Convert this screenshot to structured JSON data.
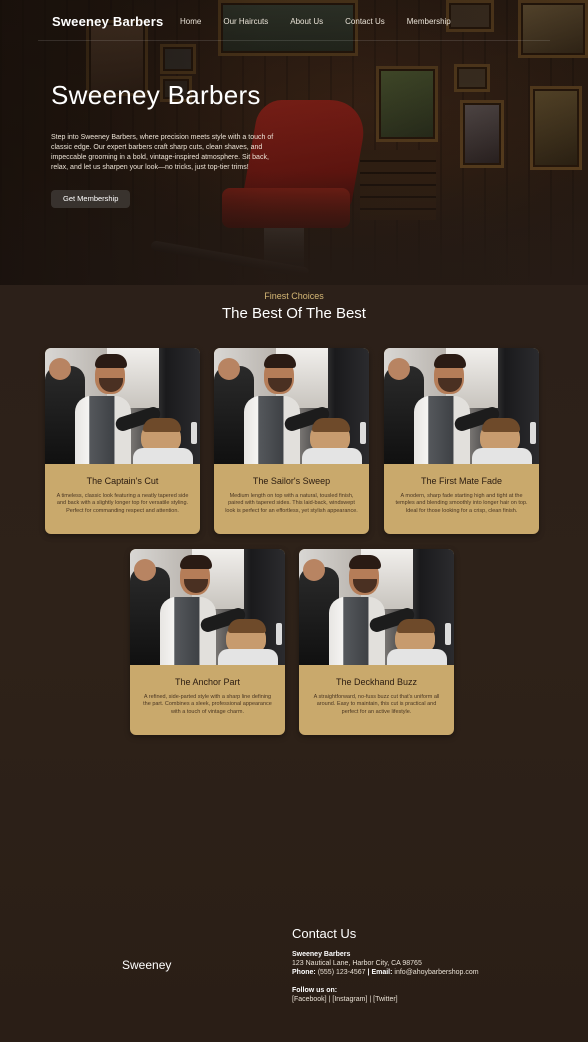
{
  "nav": {
    "brand": "Sweeney Barbers",
    "links": [
      "Home",
      "Our Haircuts",
      "About Us",
      "Contact Us",
      "Membership"
    ]
  },
  "hero": {
    "title": "Sweeney Barbers",
    "description": "Step into Sweeney Barbers, where precision meets style with a touch of classic edge. Our expert barbers craft sharp cuts, clean shaves, and impeccable grooming in a bold, vintage-inspired atmosphere. Sit back, relax, and let us sharpen your look—no tricks, just top-tier trims!",
    "button_label": "Get Membership"
  },
  "services": {
    "eyebrow": "Finest Choices",
    "title": "The Best Of The Best",
    "cards": [
      {
        "title": "The Captain's Cut",
        "description": "A timeless, classic look featuring a neatly tapered side and back with a slightly longer top for versatile styling. Perfect for commanding respect and attention."
      },
      {
        "title": "The Sailor's Sweep",
        "description": "Medium length on top with a natural, tousled finish, paired with tapered sides. This laid-back, windswept look is perfect for an effortless, yet stylish appearance."
      },
      {
        "title": "The First Mate Fade",
        "description": "A modern, sharp fade starting high and tight at the temples and blending smoothly into longer hair on top. Ideal for those looking for a crisp, clean finish."
      },
      {
        "title": "The Anchor Part",
        "description": "A refined, side-parted style with a sharp line defining the part. Combines a sleek, professional appearance with a touch of vintage charm."
      },
      {
        "title": "The Deckhand Buzz",
        "description": "A straightforward, no-fuss buzz cut that's uniform all around. Easy to maintain, this cut is practical and perfect for an active lifestyle."
      }
    ]
  },
  "footer": {
    "brand": "Sweeney",
    "contact_title": "Contact Us",
    "business_name": "Sweeney Barbers",
    "address": "123 Nautical Lane, Harbor City, CA 98765",
    "phone_label": "Phone:",
    "phone": "(555) 123-4567",
    "separator": "|",
    "email_label": "Email:",
    "email": "info@ahoybarbershop.com",
    "follow_label": "Follow us on:",
    "social": [
      "[Facebook]",
      "[Instagram]",
      "[Twitter]"
    ]
  },
  "colors": {
    "background": "#2c2019",
    "accent_gold": "#c9a96c",
    "eyebrow_gold": "#d6b876"
  }
}
